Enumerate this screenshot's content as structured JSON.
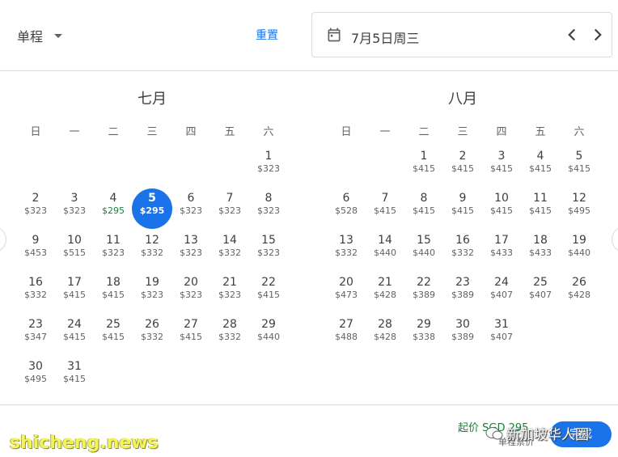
{
  "header": {
    "trip_type": "单程",
    "reset_label": "重置",
    "date_value": "7月5日周三"
  },
  "weekdays": [
    "日",
    "一",
    "二",
    "三",
    "四",
    "五",
    "六"
  ],
  "months": [
    {
      "title": "七月",
      "offset": 6,
      "days": [
        {
          "d": "1",
          "p": "$323"
        },
        {
          "d": "2",
          "p": "$323"
        },
        {
          "d": "3",
          "p": "$323"
        },
        {
          "d": "4",
          "p": "$295",
          "low": true
        },
        {
          "d": "5",
          "p": "$295",
          "selected": true
        },
        {
          "d": "6",
          "p": "$323"
        },
        {
          "d": "7",
          "p": "$323"
        },
        {
          "d": "8",
          "p": "$323"
        },
        {
          "d": "9",
          "p": "$453"
        },
        {
          "d": "10",
          "p": "$515"
        },
        {
          "d": "11",
          "p": "$323"
        },
        {
          "d": "12",
          "p": "$332"
        },
        {
          "d": "13",
          "p": "$323"
        },
        {
          "d": "14",
          "p": "$332"
        },
        {
          "d": "15",
          "p": "$323"
        },
        {
          "d": "16",
          "p": "$332"
        },
        {
          "d": "17",
          "p": "$415"
        },
        {
          "d": "18",
          "p": "$415"
        },
        {
          "d": "19",
          "p": "$323"
        },
        {
          "d": "20",
          "p": "$323"
        },
        {
          "d": "21",
          "p": "$323"
        },
        {
          "d": "22",
          "p": "$415"
        },
        {
          "d": "23",
          "p": "$347"
        },
        {
          "d": "24",
          "p": "$415"
        },
        {
          "d": "25",
          "p": "$415"
        },
        {
          "d": "26",
          "p": "$332"
        },
        {
          "d": "27",
          "p": "$415"
        },
        {
          "d": "28",
          "p": "$332"
        },
        {
          "d": "29",
          "p": "$440"
        },
        {
          "d": "30",
          "p": "$495"
        },
        {
          "d": "31",
          "p": "$415"
        }
      ]
    },
    {
      "title": "八月",
      "offset": 2,
      "days": [
        {
          "d": "1",
          "p": "$415"
        },
        {
          "d": "2",
          "p": "$415"
        },
        {
          "d": "3",
          "p": "$415"
        },
        {
          "d": "4",
          "p": "$415"
        },
        {
          "d": "5",
          "p": "$415"
        },
        {
          "d": "6",
          "p": "$528"
        },
        {
          "d": "7",
          "p": "$415"
        },
        {
          "d": "8",
          "p": "$415"
        },
        {
          "d": "9",
          "p": "$415"
        },
        {
          "d": "10",
          "p": "$415"
        },
        {
          "d": "11",
          "p": "$415"
        },
        {
          "d": "12",
          "p": "$495"
        },
        {
          "d": "13",
          "p": "$332"
        },
        {
          "d": "14",
          "p": "$440"
        },
        {
          "d": "15",
          "p": "$440"
        },
        {
          "d": "16",
          "p": "$332"
        },
        {
          "d": "17",
          "p": "$433"
        },
        {
          "d": "18",
          "p": "$433"
        },
        {
          "d": "19",
          "p": "$440"
        },
        {
          "d": "20",
          "p": "$473"
        },
        {
          "d": "21",
          "p": "$428"
        },
        {
          "d": "22",
          "p": "$389"
        },
        {
          "d": "23",
          "p": "$389"
        },
        {
          "d": "24",
          "p": "$407"
        },
        {
          "d": "25",
          "p": "$407"
        },
        {
          "d": "26",
          "p": "$428"
        },
        {
          "d": "27",
          "p": "$488"
        },
        {
          "d": "28",
          "p": "$428"
        },
        {
          "d": "29",
          "p": "$338"
        },
        {
          "d": "30",
          "p": "$389"
        },
        {
          "d": "31",
          "p": "$407"
        }
      ]
    }
  ],
  "footer": {
    "min_price": "起价 SGD 295",
    "fare_type": "单程票价",
    "done_label": "完成"
  },
  "watermarks": {
    "site": "shicheng.news",
    "brand": "新加坡华人圈"
  },
  "colors": {
    "accent": "#1a73e8",
    "low_price": "#188038",
    "text": "#3c4043",
    "muted": "#5f6368",
    "border": "#dadce0"
  },
  "icons": [
    "chevron-down-icon",
    "calendar-icon",
    "chevron-left-icon",
    "chevron-right-icon"
  ]
}
